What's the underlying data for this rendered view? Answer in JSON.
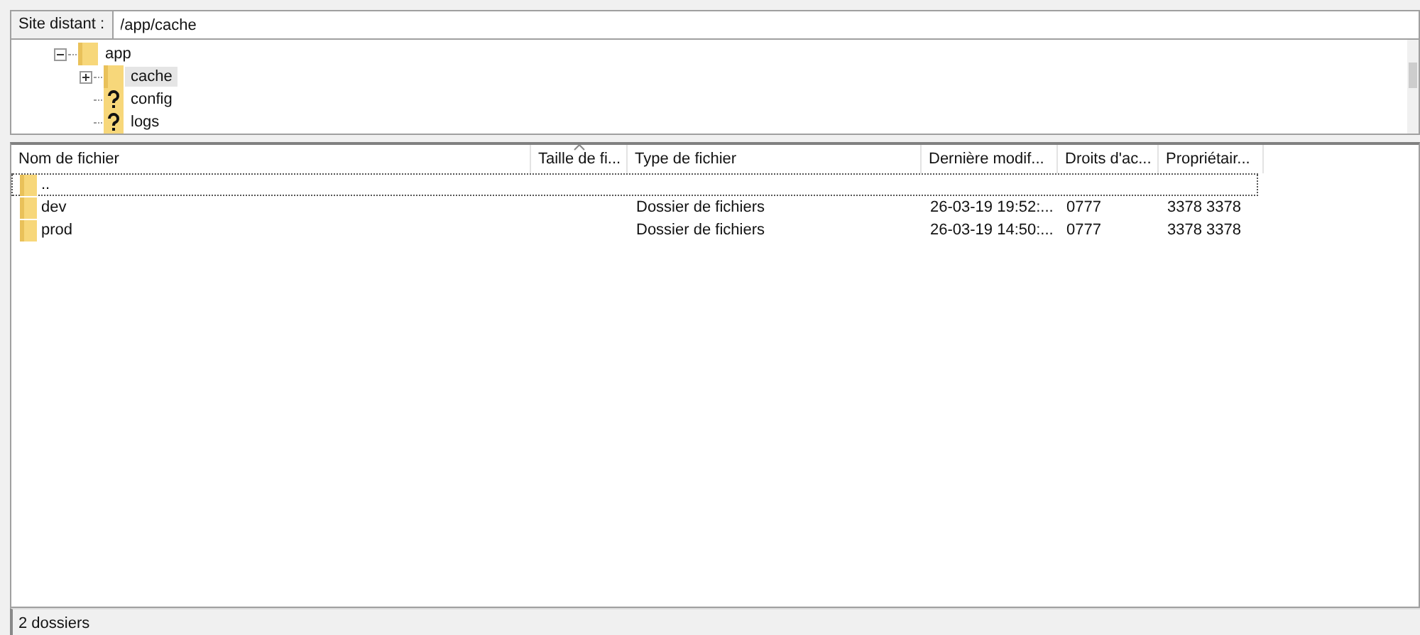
{
  "remote_site": {
    "label": "Site distant :",
    "path": "/app/cache"
  },
  "tree": [
    {
      "name": "app",
      "kind": "folder",
      "expanded": true,
      "selected": false,
      "children": [
        {
          "name": "cache",
          "kind": "folder",
          "expanded": false,
          "selected": true
        },
        {
          "name": "config",
          "kind": "unknown",
          "selected": false
        },
        {
          "name": "logs",
          "kind": "unknown",
          "selected": false
        }
      ]
    }
  ],
  "table": {
    "columns": [
      {
        "label": "Nom de fichier",
        "sorted": false
      },
      {
        "label": "Taille de fi...",
        "sorted": true
      },
      {
        "label": "Type de fichier",
        "sorted": false
      },
      {
        "label": "Dernière modif...",
        "sorted": false
      },
      {
        "label": "Droits d'ac...",
        "sorted": false
      },
      {
        "label": "Propriétair...",
        "sorted": false
      }
    ],
    "rows": [
      {
        "cells": [
          "..",
          "",
          "",
          "",
          "",
          ""
        ],
        "focused": true
      },
      {
        "cells": [
          "dev",
          "",
          "Dossier de fichiers",
          "26-03-19 19:52:...",
          "0777",
          "3378 3378"
        ],
        "focused": false
      },
      {
        "cells": [
          "prod",
          "",
          "Dossier de fichiers",
          "26-03-19 14:50:...",
          "0777",
          "3378 3378"
        ],
        "focused": false
      }
    ]
  },
  "status_bar": "2 dossiers"
}
